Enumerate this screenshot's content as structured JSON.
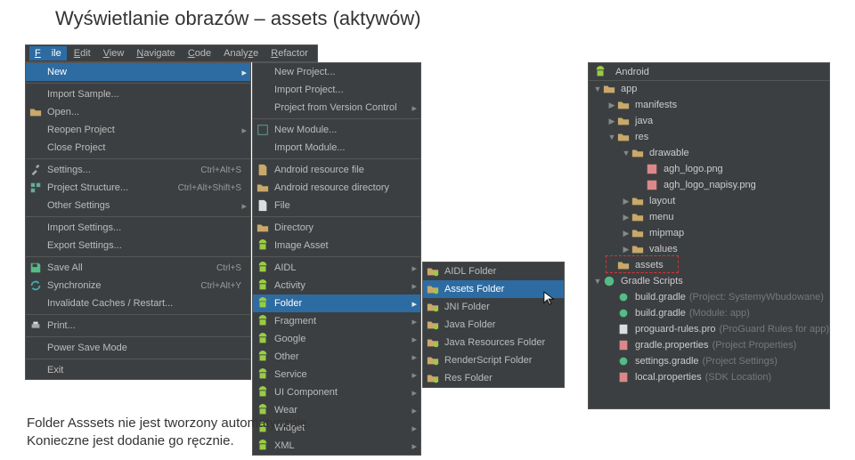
{
  "doc": {
    "title": "Wyświetlanie obrazów – assets (aktywów)",
    "footer_l1": "Folder Asssets nie jest tworzony automatycznie.",
    "footer_l2": "Konieczne jest dodanie go ręcznie."
  },
  "menubar": {
    "file": "File",
    "edit": "Edit",
    "view": "View",
    "nav": "Navigate",
    "code": "Code",
    "analyze": "Analyze",
    "refactor": "Refactor"
  },
  "menu1": {
    "new": "New",
    "import_sample": "Import Sample...",
    "open": "Open...",
    "reopen": "Reopen Project",
    "close": "Close Project",
    "settings": "Settings...",
    "settings_sc": "Ctrl+Alt+S",
    "proj_struct": "Project Structure...",
    "proj_struct_sc": "Ctrl+Alt+Shift+S",
    "other_settings": "Other Settings",
    "import_settings": "Import Settings...",
    "export_settings": "Export Settings...",
    "save_all": "Save All",
    "save_all_sc": "Ctrl+S",
    "sync": "Synchronize",
    "sync_sc": "Ctrl+Alt+Y",
    "inval": "Invalidate Caches / Restart...",
    "print": "Print...",
    "psm": "Power Save Mode",
    "exit": "Exit"
  },
  "menu2": {
    "new_project": "New Project...",
    "import_project": "Import Project...",
    "pvc": "Project from Version Control",
    "new_module": "New Module...",
    "import_module": "Import Module...",
    "ares_file": "Android resource file",
    "ares_dir": "Android resource directory",
    "file": "File",
    "directory": "Directory",
    "image_asset": "Image Asset",
    "aidl": "AIDL",
    "activity": "Activity",
    "folder": "Folder",
    "fragment": "Fragment",
    "google": "Google",
    "other": "Other",
    "service": "Service",
    "ui_comp": "UI Component",
    "wear": "Wear",
    "widget": "Widget",
    "xml": "XML"
  },
  "menu3": {
    "aidl": "AIDL Folder",
    "assets": "Assets Folder",
    "jni": "JNI Folder",
    "java": "Java Folder",
    "javares": "Java Resources Folder",
    "render": "RenderScript Folder",
    "res": "Res Folder"
  },
  "proj": {
    "header": "Android",
    "app": "app",
    "manifests": "manifests",
    "java": "java",
    "res": "res",
    "drawable": "drawable",
    "agh_logo": "agh_logo.png",
    "agh_logo_napisy": "agh_logo_napisy.png",
    "layout": "layout",
    "menu": "menu",
    "mipmap": "mipmap",
    "values": "values",
    "assets": "assets",
    "gradle_scripts": "Gradle Scripts",
    "bg1": "build.gradle",
    "bg1m": "(Project: SystemyWbudowane)",
    "bg2": "build.gradle",
    "bg2m": "(Module: app)",
    "prog": "proguard-rules.pro",
    "progm": "(ProGuard Rules for app)",
    "gp": "gradle.properties",
    "gpm": "(Project Properties)",
    "sg": "settings.gradle",
    "sgm": "(Project Settings)",
    "lp": "local.properties",
    "lpm": "(SDK Location)"
  }
}
